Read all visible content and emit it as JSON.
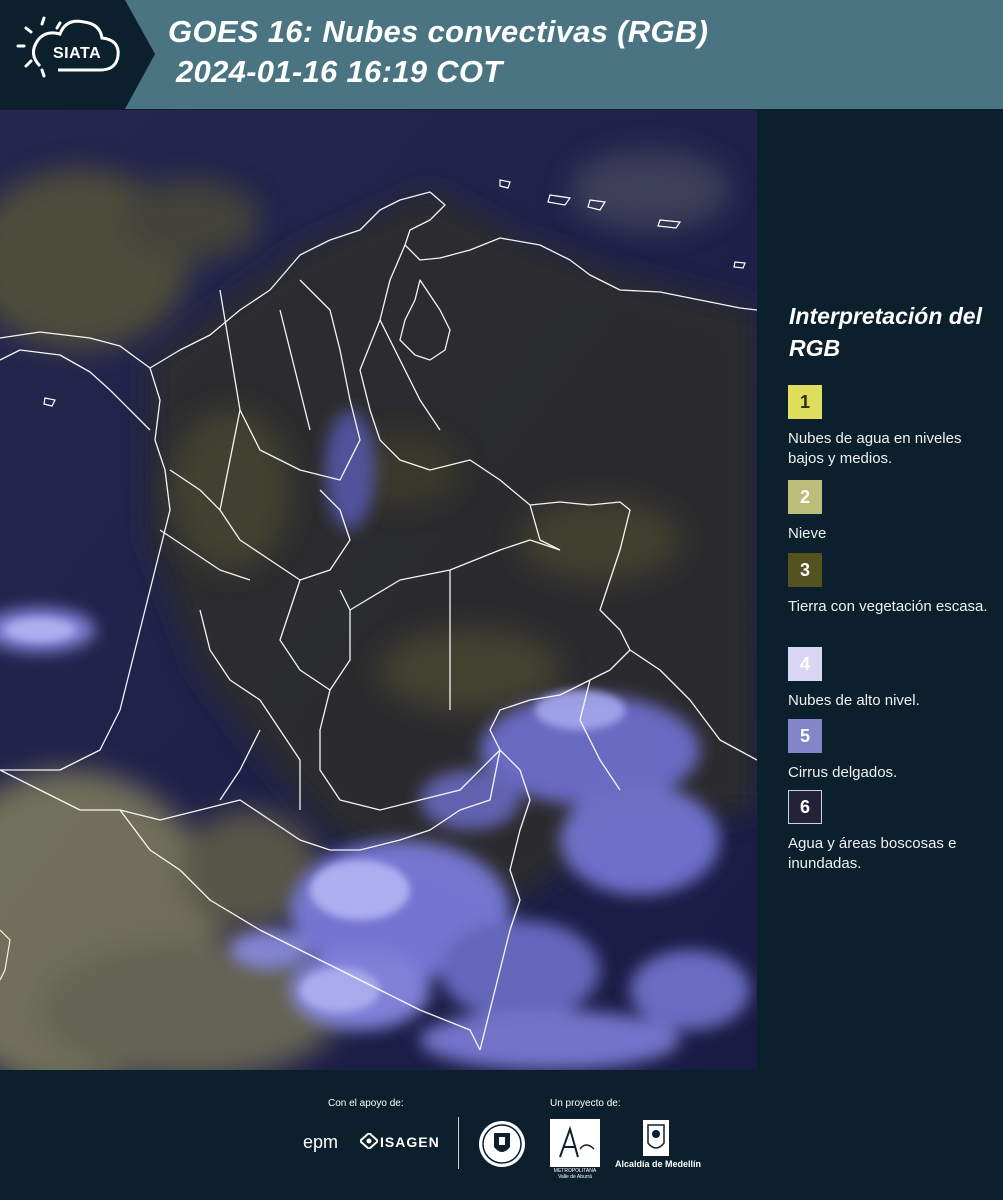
{
  "header": {
    "logo_text": "SIATA",
    "title_line1": "GOES 16: Nubes convectivas (RGB)",
    "title_line2": "2024-01-16 16:19 COT"
  },
  "colors": {
    "header_bg": "#4a7482",
    "page_bg": "#0b1f2c",
    "map_base": "#1b1c4a",
    "boundary": "#ffffff"
  },
  "map": {
    "description_icon": "satellite-rgb-map",
    "features": [
      "country-borders",
      "department-borders",
      "coastline",
      "cloud-cover"
    ]
  },
  "legend": {
    "title": "Interpretación del RGB",
    "items": [
      {
        "number": "1",
        "color": "#dede5c",
        "label": "Nubes de agua en niveles bajos y medios."
      },
      {
        "number": "2",
        "color": "#bdbd7a",
        "label": "Nieve"
      },
      {
        "number": "3",
        "color": "#54531f",
        "label": "Tierra con vegetación escasa."
      },
      {
        "number": "4",
        "color": "#d8d8f4",
        "label": "Nubes de alto nivel."
      },
      {
        "number": "5",
        "color": "#8585c9",
        "label": "Cirrus delgados."
      },
      {
        "number": "6",
        "color": "#232338",
        "label": "Agua y áreas boscosas e inundadas."
      }
    ]
  },
  "footer": {
    "support_label": "Con el apoyo de:",
    "project_label": "Un proyecto de:",
    "sponsors": [
      "epm",
      "ISAGEN"
    ],
    "area_label": "METROPOLITANA Valle de Aburrá",
    "alcaldia_label": "Alcaldía de Medellín"
  }
}
